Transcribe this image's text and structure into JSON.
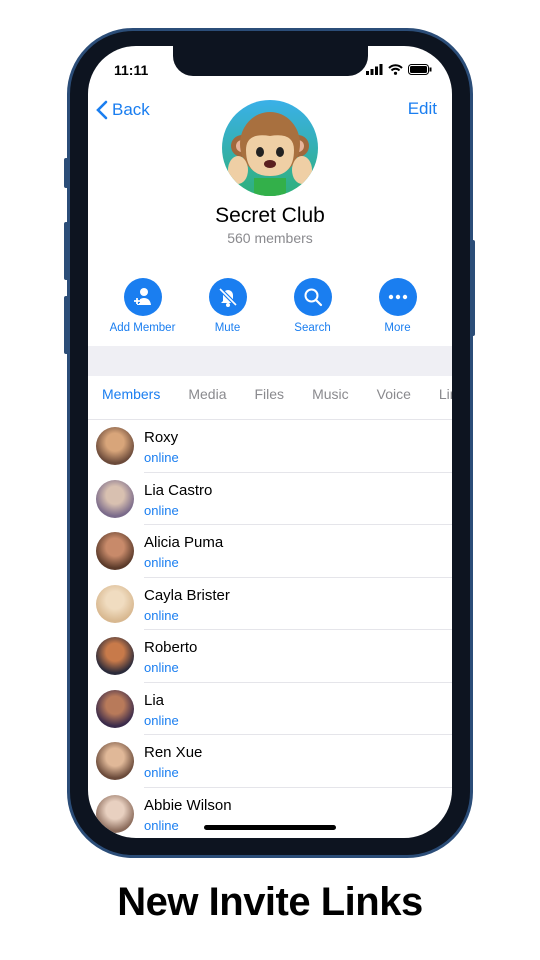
{
  "status": {
    "time": "11:11"
  },
  "nav": {
    "back": "Back",
    "edit": "Edit"
  },
  "group": {
    "name": "Secret Club",
    "members": "560 members",
    "avatar": "see-no-evil-monkey-emoji"
  },
  "actions": [
    {
      "label": "Add Member",
      "icon": "add-user-icon"
    },
    {
      "label": "Mute",
      "icon": "bell-slash-icon"
    },
    {
      "label": "Search",
      "icon": "search-icon"
    },
    {
      "label": "More",
      "icon": "more-icon"
    }
  ],
  "tabs": [
    "Members",
    "Media",
    "Files",
    "Music",
    "Voice",
    "Links"
  ],
  "members": [
    {
      "name": "Roxy",
      "status": "online"
    },
    {
      "name": "Lia Castro",
      "status": "online"
    },
    {
      "name": "Alicia Puma",
      "status": "online"
    },
    {
      "name": "Cayla Brister",
      "status": "online"
    },
    {
      "name": "Roberto",
      "status": "online"
    },
    {
      "name": "Lia",
      "status": "online"
    },
    {
      "name": "Ren Xue",
      "status": "online"
    },
    {
      "name": "Abbie Wilson",
      "status": "online"
    }
  ],
  "caption": "New Invite Links",
  "colors": {
    "accent": "#1a7ef0",
    "frame": "#2b4d78"
  }
}
